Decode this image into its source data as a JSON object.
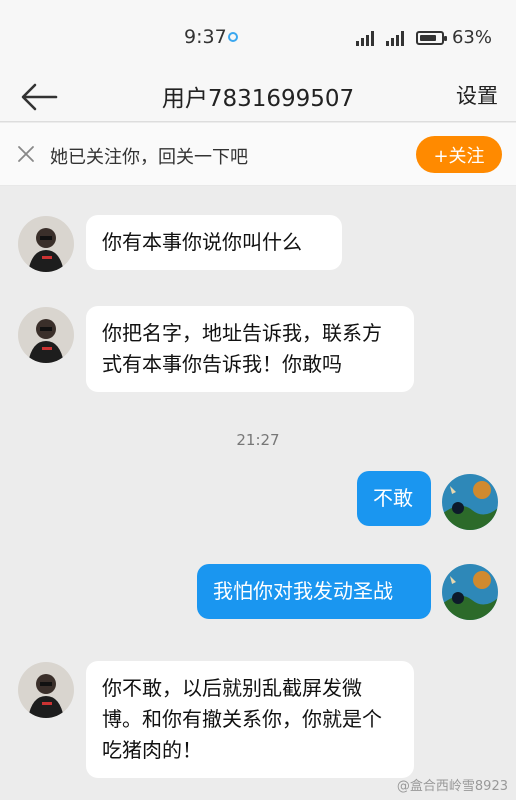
{
  "status_bar": {
    "time": "9:37",
    "battery": "63%"
  },
  "nav": {
    "title": "用户7831699507",
    "settings_label": "设置"
  },
  "follow_bar": {
    "text": "她已关注你，回关一下吧",
    "button_label": "+关注",
    "accent": "#ff8a00"
  },
  "messages": [
    {
      "side": "left",
      "text": "你有本事你说你叫什么"
    },
    {
      "side": "left",
      "text": "你把名字，地址告诉我，联系方式有本事你告诉我！你敢吗"
    },
    {
      "side": "right",
      "text": "不敢"
    },
    {
      "side": "right",
      "text": "我怕你对我发动圣战"
    },
    {
      "side": "left",
      "text": "你不敢，以后就别乱截屏发微博。和你有撤关系你，你就是个吃猪肉的！"
    }
  ],
  "timestamp": "21:27",
  "watermark": "@盒合西岭雪8923",
  "colors": {
    "bubble_right": "#1a96f0",
    "bubble_left": "#ffffff",
    "background": "#ececec"
  }
}
